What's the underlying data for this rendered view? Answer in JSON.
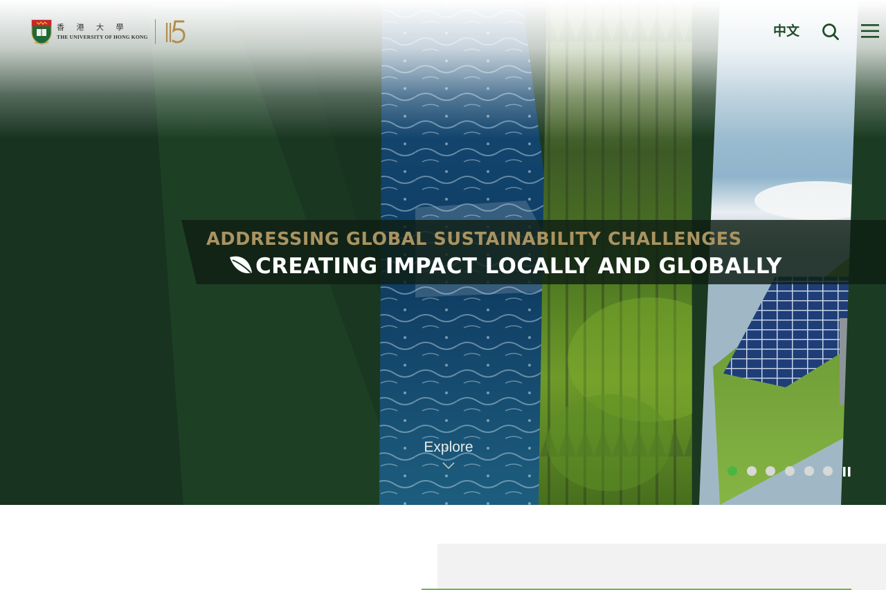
{
  "header": {
    "logo": {
      "name_zh": "香 港 大 學",
      "name_en": "THE UNIVERSITY OF HONG KONG",
      "anniversary_mark": "115",
      "crest_icon": "hku-crest-icon"
    },
    "language_label": "中文",
    "search_icon": "search-icon",
    "menu_icon": "hamburger-menu-icon"
  },
  "hero": {
    "headline_line1": "ADDRESSING GLOBAL SUSTAINABILITY CHALLENGES",
    "headline_line2": "CREATING IMPACT LOCALLY AND GLOBALLY",
    "headline_icon": "leaf-icon",
    "explore_label": "Explore",
    "explore_icon": "chevron-down-icon",
    "slides": {
      "total": 6,
      "active_index": 0
    },
    "pause_icon": "pause-icon"
  },
  "colors": {
    "brand_green": "#1d4d25",
    "hero_dark_green": "#193a21",
    "gold": "#a99361",
    "active_dot": "#4bb543",
    "inactive_dot": "#d6d9d5",
    "accent_rule": "#6fb54a"
  }
}
